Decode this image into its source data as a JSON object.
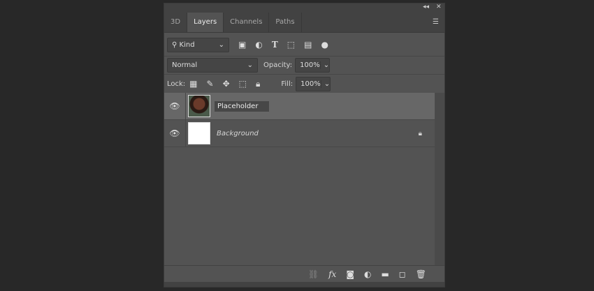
{
  "window": {
    "collapse_icon": "double-chevron-left-icon",
    "close_icon": "close-icon"
  },
  "tabs": [
    {
      "label": "3D"
    },
    {
      "label": "Layers",
      "active": true
    },
    {
      "label": "Channels"
    },
    {
      "label": "Paths"
    }
  ],
  "filter": {
    "label": "Kind"
  },
  "blend": {
    "mode": "Normal",
    "opacity_label": "Opacity:",
    "opacity": "100%"
  },
  "lock": {
    "label": "Lock:",
    "fill_label": "Fill:",
    "fill": "100%"
  },
  "layers": [
    {
      "name": "Placeholder",
      "selected": true,
      "editing": true
    },
    {
      "name": "Background",
      "locked": true
    }
  ],
  "colors": {
    "panel": "#535353",
    "selected": "#676767",
    "header": "#424242"
  }
}
